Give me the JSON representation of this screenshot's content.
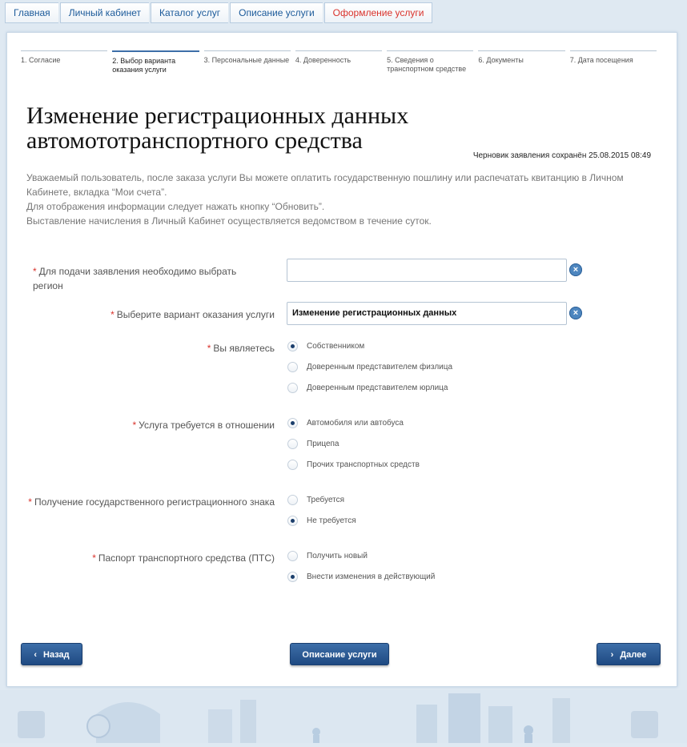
{
  "breadcrumbs": [
    "Главная",
    "Личный кабинет",
    "Каталог услуг",
    "Описание услуги",
    "Оформление услуги"
  ],
  "steps": [
    {
      "label": "1. Согласие",
      "active": false
    },
    {
      "label": "2. Выбор варианта оказания услуги",
      "active": true
    },
    {
      "label": "3. Персональные данные",
      "active": false
    },
    {
      "label": "4. Доверенность",
      "active": false
    },
    {
      "label": "5. Сведения о транспортном средстве",
      "active": false
    },
    {
      "label": "6. Документы",
      "active": false
    },
    {
      "label": "7. Дата посещения",
      "active": false
    }
  ],
  "page": {
    "title": "Изменение регистрационных данных автомототранспортного средства",
    "draft_status": "Черновик заявления сохранён 25.08.2015 08:49",
    "info": [
      "Уважаемый пользователь, после заказа услуги Вы можете оплатить государственную пошлину или распечатать квитанцию в Личном Кабинете, вкладка “Мои счета”.",
      "Для отображения информации следует нажать кнопку “Обновить”.",
      "Выставление начисления в Личный Кабинет осуществляется ведомством в течение суток."
    ]
  },
  "form": {
    "required_mark": "*",
    "region": {
      "label": "Для подачи заявления необходимо выбрать регион",
      "value": ""
    },
    "variant": {
      "label": "Выберите вариант оказания услуги",
      "value": "Изменение регистрационных данных"
    },
    "clear_icon": "×",
    "role": {
      "label": "Вы являетесь",
      "options": [
        "Собственником",
        "Доверенным представителем физлица",
        "Доверенным представителем юрлица"
      ],
      "selected": 0
    },
    "vehicle": {
      "label": "Услуга требуется в отношении",
      "options": [
        "Автомобиля или автобуса",
        "Прицепа",
        "Прочих транспортных средств"
      ],
      "selected": 0
    },
    "plate": {
      "label": "Получение государственного регистрационного знака",
      "options": [
        "Требуется",
        "Не требуется"
      ],
      "selected": 1
    },
    "pts": {
      "label": "Паспорт транспортного средства (ПТС)",
      "options": [
        "Получить новый",
        "Внести изменения в действующий"
      ],
      "selected": 1
    }
  },
  "buttons": {
    "back": "Назад",
    "description": "Описание услуги",
    "next": "Далее",
    "back_icon": "‹",
    "next_icon": "›"
  },
  "colors": {
    "accent": "#1f4a82",
    "required": "#d9322b",
    "active_crumb": "#d9322b"
  }
}
